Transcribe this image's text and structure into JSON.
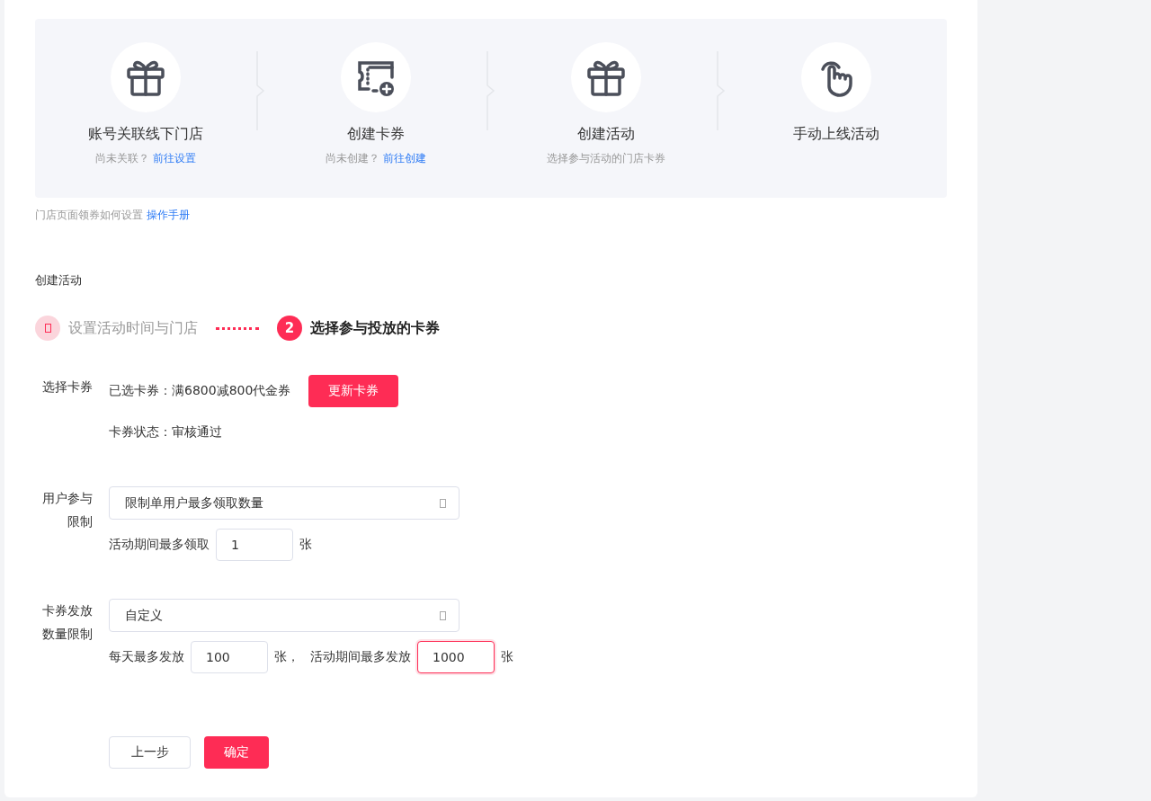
{
  "guide_steps": [
    {
      "kind": "gift",
      "title": "账号关联线下门店",
      "hint": "尚未关联？",
      "link": "前往设置"
    },
    {
      "kind": "ticket",
      "title": "创建卡券",
      "hint": "尚未创建？",
      "link": "前往创建"
    },
    {
      "kind": "gift",
      "title": "创建活动",
      "hint": "选择参与活动的门店卡券"
    },
    {
      "kind": "hand",
      "title": "手动上线活动"
    }
  ],
  "guide_note": {
    "text": "门店页面领券如何设置",
    "link": "操作手册"
  },
  "section_title": "创建活动",
  "wizard": [
    {
      "label": "设置活动时间与门店",
      "selected": false
    },
    {
      "label": "选择参与投放的卡券",
      "number": "2",
      "selected": true
    }
  ],
  "coupon": {
    "label": "选择卡券",
    "selected_text": "已选卡券：满6800减800代金券",
    "button": "更新卡券",
    "status": "卡券状态：审核通过"
  },
  "user_limit": {
    "label": "用户参与限制",
    "select": "限制单用户最多领取数量",
    "inputs": [
      {
        "before": "活动期间最多领取",
        "value": "1",
        "after": "张",
        "focused": false
      }
    ]
  },
  "issue_limit": {
    "label": "卡券发放数量限制",
    "select": "自定义",
    "inputs": [
      {
        "before": "每天最多发放",
        "value": "100",
        "after": "张，",
        "focused": false
      },
      {
        "before": "活动期间最多发放",
        "value": "1000",
        "after": "张",
        "focused": true
      }
    ]
  },
  "buttons": {
    "back": "上一步",
    "confirm": "确定"
  }
}
